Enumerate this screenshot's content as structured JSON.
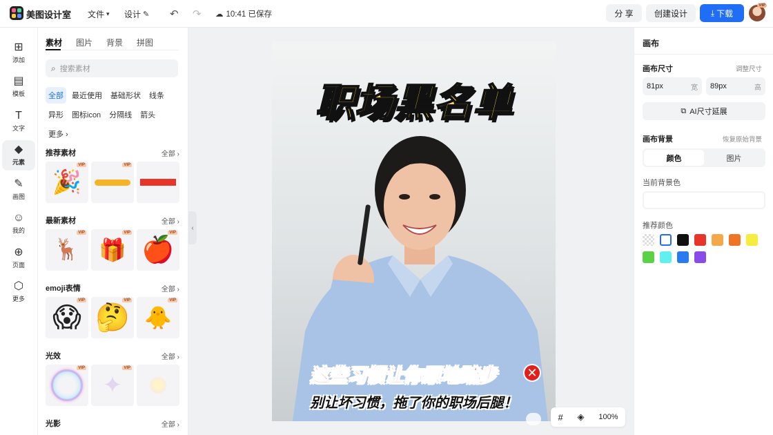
{
  "app": {
    "name": "美图设计室"
  },
  "topbar": {
    "file_menu": "文件",
    "design_menu": "设计",
    "saved_status": "10:41 已保存",
    "share_label": "分 享",
    "create_label": "创建设计",
    "download_label": "下载",
    "avatar_badge": "VIP",
    "accent": "#1f6ef5"
  },
  "rail": {
    "items": [
      {
        "label": "添加",
        "icon": "plus-square-icon"
      },
      {
        "label": "模板",
        "icon": "template-icon"
      },
      {
        "label": "文字",
        "icon": "text-icon"
      },
      {
        "label": "元素",
        "icon": "shapes-icon"
      },
      {
        "label": "画图",
        "icon": "draw-icon"
      },
      {
        "label": "我的",
        "icon": "user-icon"
      },
      {
        "label": "页面",
        "icon": "page-icon"
      },
      {
        "label": "更多",
        "icon": "cube-icon"
      }
    ]
  },
  "panel": {
    "tabs": [
      "素材",
      "图片",
      "背景",
      "拼图"
    ],
    "search_placeholder": "搜索素材",
    "chips": [
      "全部",
      "最近使用",
      "基础形状",
      "线条",
      "异形",
      "图标icon",
      "分隔线",
      "箭头",
      "更多"
    ],
    "all_label": "全部",
    "vip_label": "VIP",
    "sections": [
      {
        "title": "推荐素材"
      },
      {
        "title": "最新素材"
      },
      {
        "title": "emoji表情"
      },
      {
        "title": "光效"
      },
      {
        "title": "光影"
      }
    ]
  },
  "poster": {
    "headline": "职场黑名单",
    "sub1": "这些习惯让你原地踏步",
    "sub2": "别让坏习惯，拖了你的职场后腿！",
    "headline_color": "#f7d84a",
    "sub1_color": "#e1201c"
  },
  "zoom": {
    "level": "100%"
  },
  "right_panel": {
    "title": "画布",
    "size_label": "画布尺寸",
    "adjust_size": "调整尺寸",
    "width_value": "81px",
    "width_unit": "宽",
    "height_value": "89px",
    "height_unit": "高",
    "ai_extend": "AI尺寸延展",
    "bg_label": "画布背景",
    "restore_bg": "恢复原始背景",
    "seg_color": "颜色",
    "seg_image": "图片",
    "current_bg": "当前背景色",
    "recommended": "推荐颜色",
    "swatches": [
      "transparent",
      "#ffffff",
      "#111111",
      "#e8352a",
      "#f5a84a",
      "#ef7424",
      "#f6ee3e",
      "#5bd146",
      "#5ff0ef",
      "#2a7af0",
      "#8a4ce8"
    ]
  }
}
